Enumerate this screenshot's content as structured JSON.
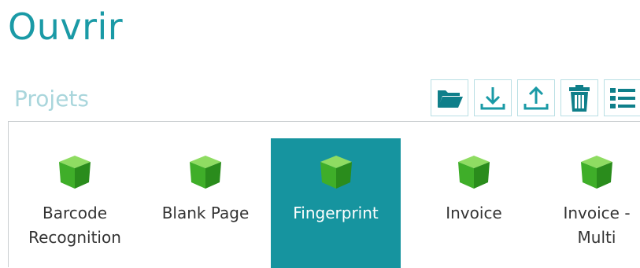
{
  "window": {
    "title": "Ouvrir"
  },
  "projects_section": {
    "title": "Projets",
    "toolbar": [
      {
        "name": "open-folder-button",
        "icon": "folder-open-icon"
      },
      {
        "name": "import-button",
        "icon": "download-icon"
      },
      {
        "name": "export-button",
        "icon": "upload-icon"
      },
      {
        "name": "delete-button",
        "icon": "trash-icon"
      },
      {
        "name": "list-view-button",
        "icon": "list-view-icon"
      }
    ],
    "items": [
      {
        "label": "Barcode\nRecognition",
        "icon": "cube-icon",
        "selected": false
      },
      {
        "label": "Blank Page",
        "icon": "cube-icon",
        "selected": false
      },
      {
        "label": "Fingerprint",
        "icon": "cube-icon",
        "selected": true
      },
      {
        "label": "Invoice",
        "icon": "cube-icon",
        "selected": false
      },
      {
        "label": "Invoice -\nMulti",
        "icon": "cube-icon",
        "selected": false
      }
    ]
  },
  "colors": {
    "accent": "#1a9aa6",
    "selection": "#16949f",
    "section_title": "#a9d6dc",
    "icon_dark": "#0f7f8a",
    "cube_green": "#3fae29"
  }
}
